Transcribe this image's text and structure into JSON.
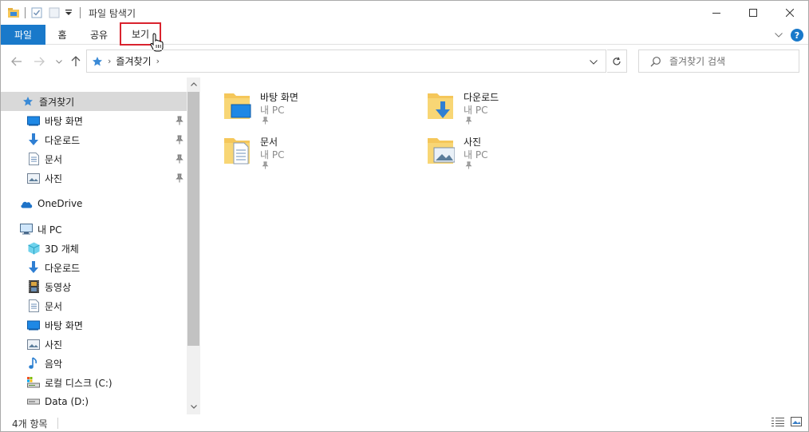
{
  "window": {
    "title": "파일 탐색기"
  },
  "ribbon": {
    "tabs": [
      {
        "label": "파일"
      },
      {
        "label": "홈"
      },
      {
        "label": "공유"
      },
      {
        "label": "보기"
      }
    ],
    "help_label": "?"
  },
  "address": {
    "crumb": "즐겨찾기",
    "search_placeholder": "즐겨찾기 검색"
  },
  "nav": {
    "items": [
      {
        "label": "즐겨찾기",
        "icon": "star-icon"
      },
      {
        "label": "바탕 화면",
        "icon": "desktop-icon"
      },
      {
        "label": "다운로드",
        "icon": "download-icon"
      },
      {
        "label": "문서",
        "icon": "document-icon"
      },
      {
        "label": "사진",
        "icon": "picture-icon"
      },
      {
        "label": "OneDrive",
        "icon": "cloud-icon"
      },
      {
        "label": "내 PC",
        "icon": "pc-icon"
      },
      {
        "label": "3D 개체",
        "icon": "cube-icon"
      },
      {
        "label": "다운로드",
        "icon": "download-icon"
      },
      {
        "label": "동영상",
        "icon": "film-icon"
      },
      {
        "label": "문서",
        "icon": "document-icon"
      },
      {
        "label": "바탕 화면",
        "icon": "desktop-icon"
      },
      {
        "label": "사진",
        "icon": "picture-icon"
      },
      {
        "label": "음악",
        "icon": "music-icon"
      },
      {
        "label": "로컬 디스크 (C:)",
        "icon": "drive-c-icon"
      },
      {
        "label": "Data (D:)",
        "icon": "drive-icon"
      }
    ]
  },
  "content": {
    "tiles": [
      {
        "name": "바탕 화면",
        "location": "내 PC"
      },
      {
        "name": "다운로드",
        "location": "내 PC"
      },
      {
        "name": "문서",
        "location": "내 PC"
      },
      {
        "name": "사진",
        "location": "내 PC"
      }
    ]
  },
  "status": {
    "count": "4개 항목"
  },
  "colors": {
    "accent": "#1979ca",
    "highlight_border": "#d9232e",
    "folder": "#f5c75a"
  }
}
